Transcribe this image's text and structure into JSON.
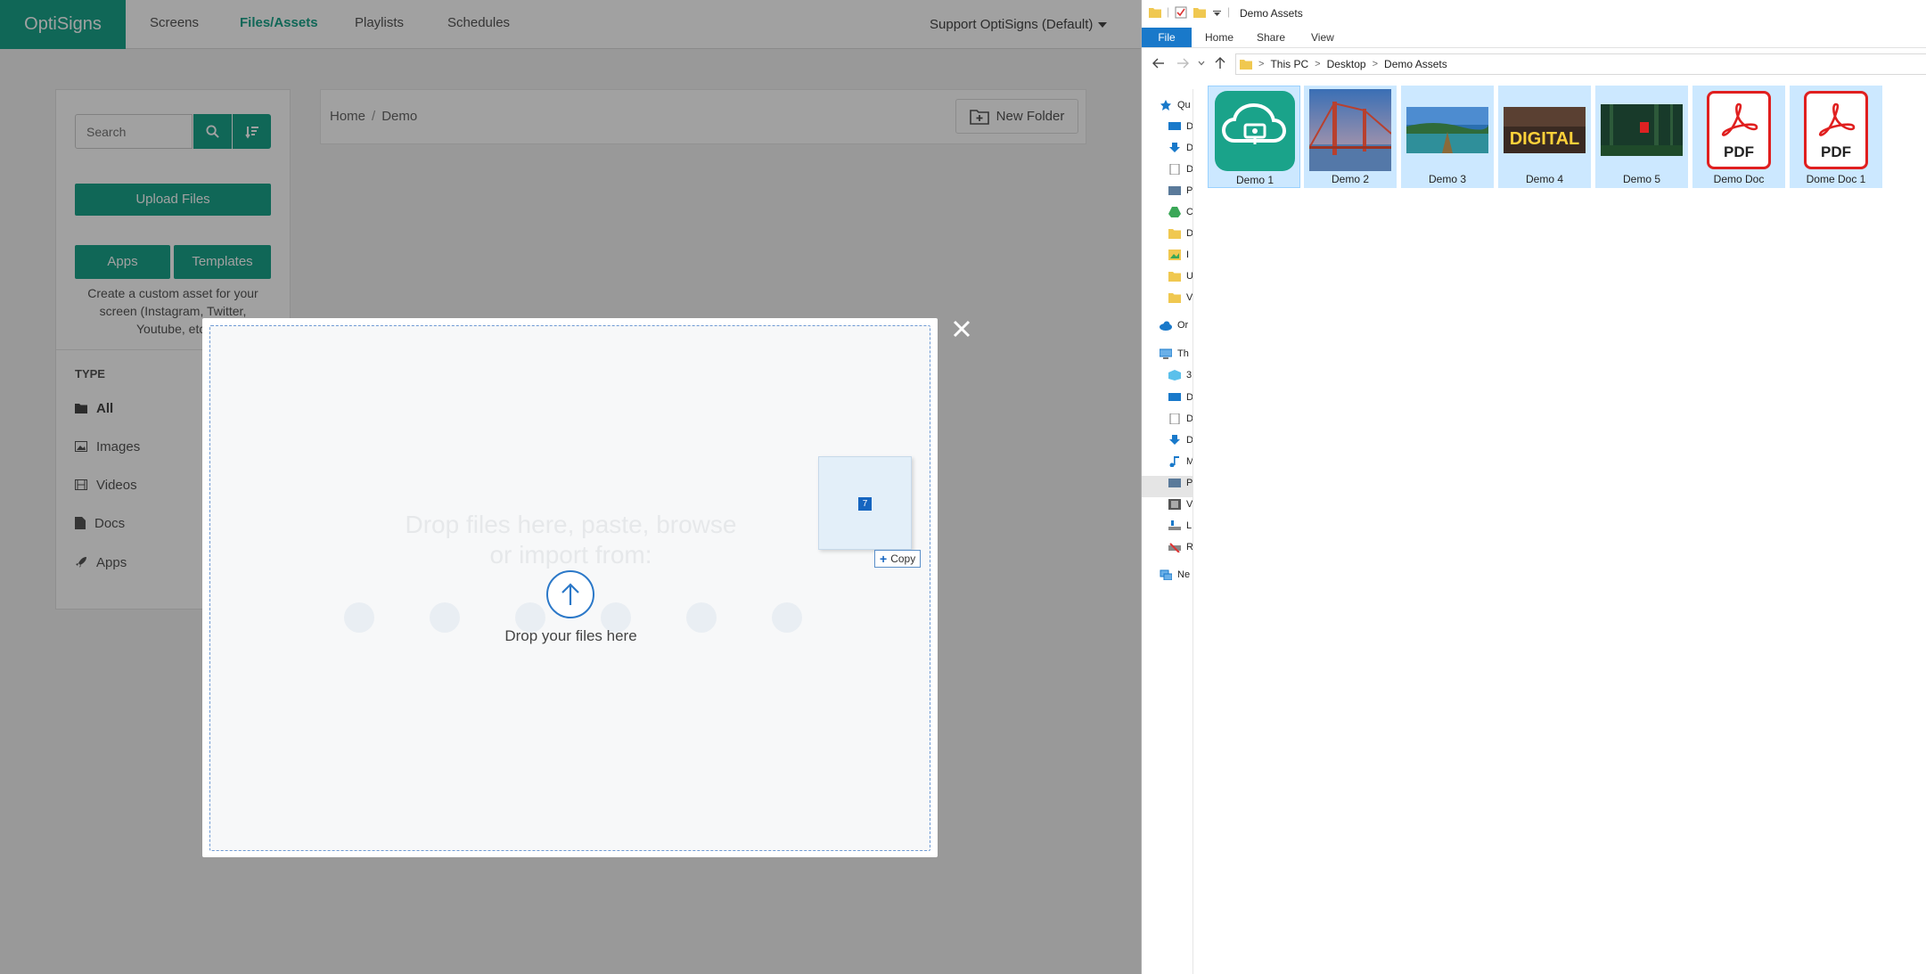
{
  "app": {
    "logo": "OptiSigns",
    "nav": [
      "Screens",
      "Files/Assets",
      "Playlists",
      "Schedules"
    ],
    "account": "Support OptiSigns (Default)"
  },
  "sidebar": {
    "search_placeholder": "Search",
    "upload_label": "Upload Files",
    "apps_label": "Apps",
    "templates_label": "Templates",
    "create_text": "Create a custom asset for your screen (Instagram, Twitter, Youtube, etc)",
    "type_heading": "TYPE",
    "types": [
      "All",
      "Images",
      "Videos",
      "Docs",
      "Apps"
    ]
  },
  "main": {
    "breadcrumb": [
      "Home",
      "Demo"
    ],
    "new_folder_label": "New Folder"
  },
  "modal": {
    "faded_line1": "Drop files here, paste, browse",
    "faded_line2": "or import from:",
    "drop_text": "Drop your files here",
    "close_symbol": "✕"
  },
  "drag": {
    "count": "7",
    "tooltip": "Copy"
  },
  "explorer": {
    "window_title": "Demo Assets",
    "ribbon_tabs": [
      "File",
      "Home",
      "Share",
      "View"
    ],
    "path": [
      "This PC",
      "Desktop",
      "Demo Assets"
    ],
    "nav_items": [
      "Qu",
      "D",
      "D",
      "D",
      "P",
      "C",
      "D",
      "I",
      "U",
      "V",
      "Or",
      "Th",
      "3",
      "D",
      "D",
      "D",
      "M",
      "P",
      "V",
      "L",
      "R",
      "Ne"
    ],
    "files": [
      "Demo 1",
      "Demo 2",
      "Demo 3",
      "Demo 4",
      "Demo 5",
      "Demo Doc",
      "Dome Doc 1"
    ],
    "pdf_text": "PDF",
    "digital_text": "DIGITAL"
  },
  "colors": {
    "brand": "#1aa38a",
    "explorer_accent": "#1979ca",
    "selection": "#cce8ff",
    "pdf_red": "#e01f1f"
  }
}
